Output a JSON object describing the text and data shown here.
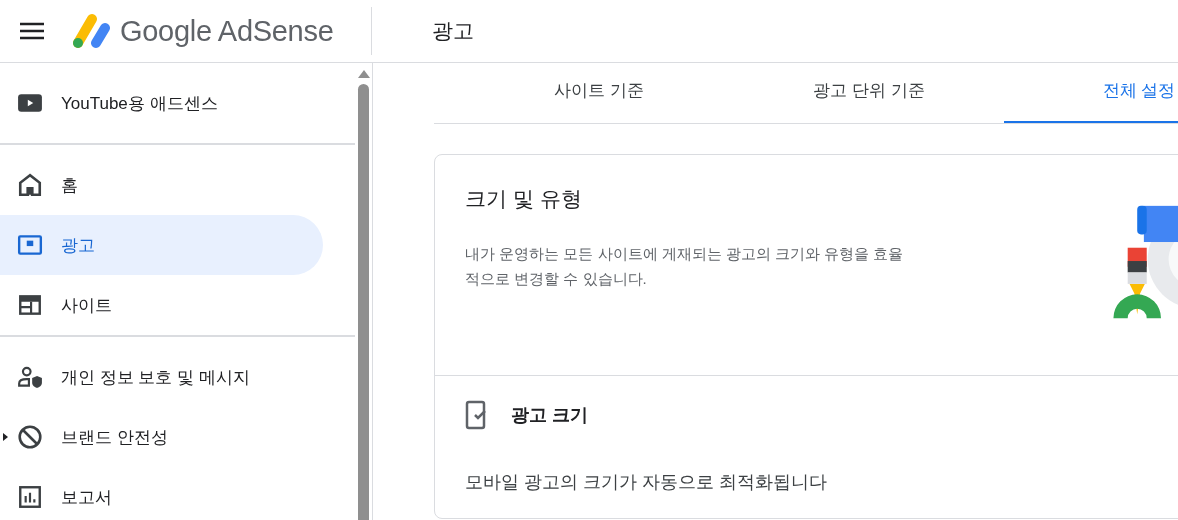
{
  "header": {
    "logo_text": "Google AdSense",
    "page_title": "광고"
  },
  "sidebar": {
    "groups": [
      [
        {
          "label": "YouTube용 애드센스",
          "selected": false,
          "expandable": false
        }
      ],
      [
        {
          "label": "홈",
          "selected": false,
          "expandable": false
        },
        {
          "label": "광고",
          "selected": true,
          "expandable": false
        },
        {
          "label": "사이트",
          "selected": false,
          "expandable": false
        }
      ],
      [
        {
          "label": "개인 정보 보호 및 메시지",
          "selected": false,
          "expandable": false
        },
        {
          "label": "브랜드 안전성",
          "selected": false,
          "expandable": true
        },
        {
          "label": "보고서",
          "selected": false,
          "expandable": false
        }
      ]
    ]
  },
  "tabs": [
    {
      "label": "사이트 기준",
      "selected": false
    },
    {
      "label": "광고 단위 기준",
      "selected": false
    },
    {
      "label": "전체 설정",
      "selected": true
    }
  ],
  "card": {
    "title": "크기 및 유형",
    "description": "내가 운영하는 모든 사이트에 게재되는 광고의 크기와 유형을 효율적으로 변경할 수 있습니다.",
    "section": {
      "title": "광고 크기",
      "text": "모바일 광고의 크기가 자동으로 최적화됩니다"
    }
  }
}
